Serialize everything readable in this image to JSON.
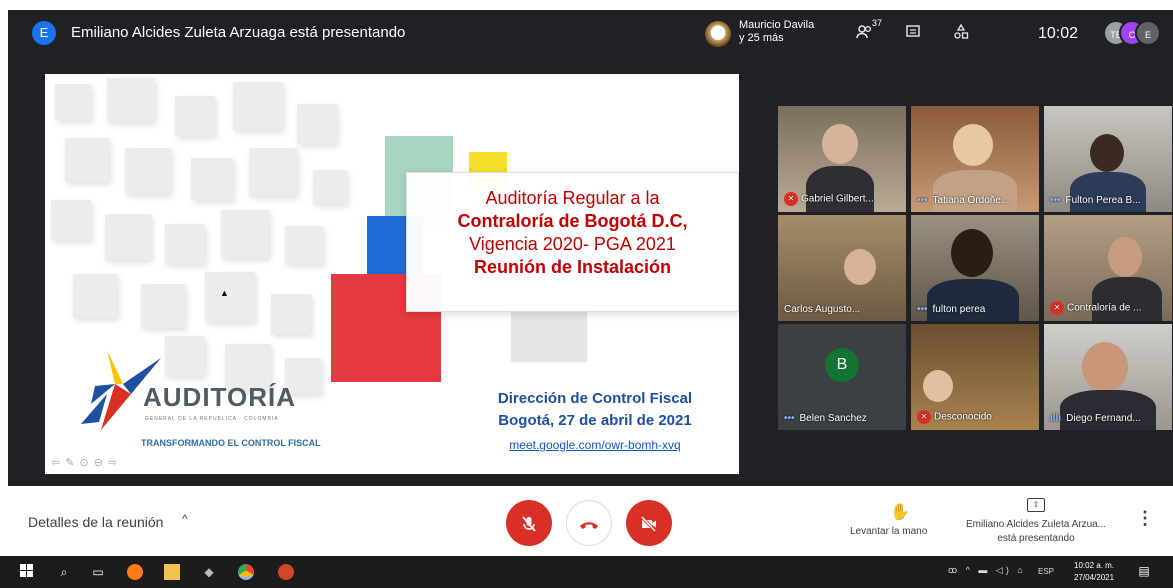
{
  "header": {
    "presenter_initial": "E",
    "presenter_text": "Emiliano Alcides Zuleta Arzuaga está presentando",
    "speaker_name": "Mauricio Davila",
    "speaker_more": "y 25 más",
    "participants_count": "37",
    "time": "10:02",
    "stack_initials": [
      "TB",
      "C",
      "E"
    ]
  },
  "slide": {
    "title_lines": [
      "Auditoría Regular a la",
      "Contraloría de Bogotá D.C,",
      "Vigencia 2020-  PGA 2021",
      "Reunión de Instalación"
    ],
    "logo_name": "AUDITORÍA",
    "logo_sub": "GENERAL DE LA REPUBLICA · COLOMBIA",
    "logo_tagline": "TRANSFORMANDO EL CONTROL FISCAL",
    "direction": "Dirección de Control Fiscal",
    "place_date": "Bogotá, 27 de abril de 2021",
    "link": "meet.google.com/owr-bomh-xvq",
    "controls": "⇦ ✎ ⊙ ⊖ ⇨"
  },
  "participants": [
    {
      "name": "Gabriel Gilbert...",
      "status": "muted"
    },
    {
      "name": "Tatiana Ordoñe...",
      "status": "dots"
    },
    {
      "name": "Fulton Perea B...",
      "status": "dots"
    },
    {
      "name": "Carlos Augusto...",
      "status": "none"
    },
    {
      "name": "fulton perea",
      "status": "dots"
    },
    {
      "name": "Contraloría de ...",
      "status": "muted"
    },
    {
      "name": "Belen Sanchez",
      "status": "dots",
      "avatar": "B"
    },
    {
      "name": "Desconocido",
      "status": "muted"
    },
    {
      "name": "Diego Fernand...",
      "status": "speaking"
    }
  ],
  "bottom": {
    "details_label": "Detalles de la reunión",
    "raise_hand_label": "Levantar la mano",
    "presenting_line1": "Emiliano Alcides Zuleta Arzua...",
    "presenting_line2": "está presentando"
  },
  "taskbar": {
    "lang": "ESP",
    "time": "10:02 a. m.",
    "date": "27/04/2021"
  },
  "colors": {
    "meet_dark": "#202124",
    "end_call_red": "#d93025",
    "slide_red": "#c00000",
    "slide_blue": "#1f4fa3"
  }
}
